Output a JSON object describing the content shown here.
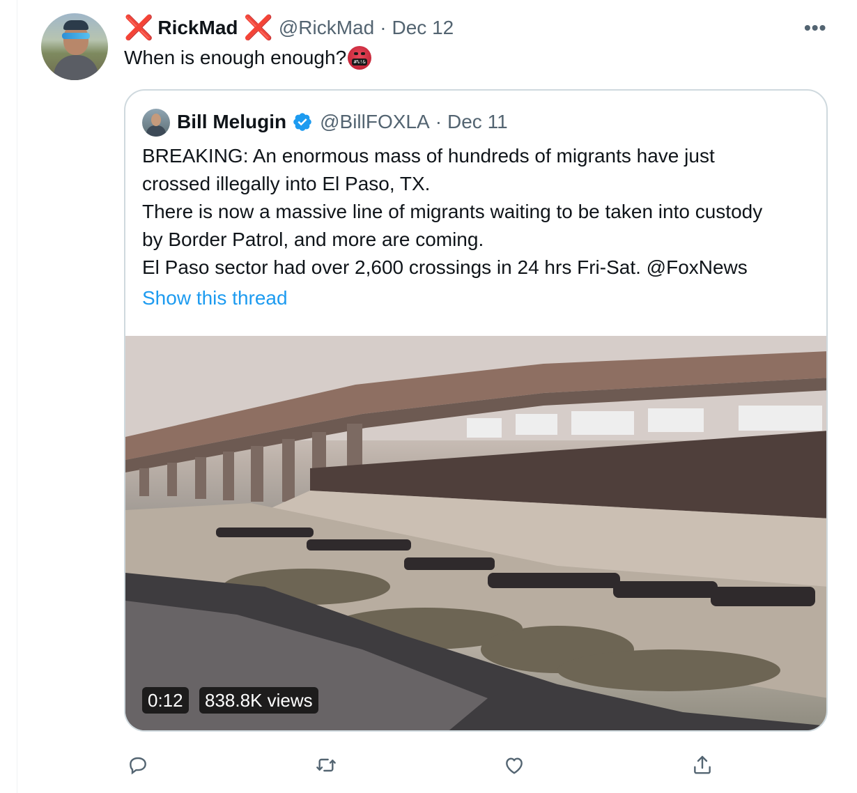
{
  "tweet": {
    "author_name": "RickMad",
    "author_handle": "@RickMad",
    "date": "Dec 12",
    "separator": "·",
    "more_label": "•••",
    "decoration_mark": "❌",
    "text": "When is enough enough?",
    "emoji": "🤬"
  },
  "quote": {
    "author_name": "Bill Melugin",
    "author_handle": "@BillFOXLA",
    "date": "Dec 11",
    "separator": "·",
    "verified": true,
    "lines": [
      "BREAKING: An enormous mass of hundreds of migrants have just",
      "crossed illegally into El Paso, TX.",
      "There is now a massive line of migrants waiting to be taken into custody",
      "by Border Patrol, and more are coming.",
      "El Paso sector had over 2,600 crossings in 24 hrs Fri-Sat. @FoxNews"
    ],
    "show_thread": "Show this thread",
    "video": {
      "duration": "0:12",
      "views": "838.8K views"
    }
  },
  "actions": {
    "reply": "reply-icon",
    "retweet": "retweet-icon",
    "like": "heart-icon",
    "share": "share-icon"
  },
  "colors": {
    "accent": "#1d9bf0",
    "muted": "#536471",
    "border": "#cfd9de",
    "x_mark": "#e0384a"
  }
}
